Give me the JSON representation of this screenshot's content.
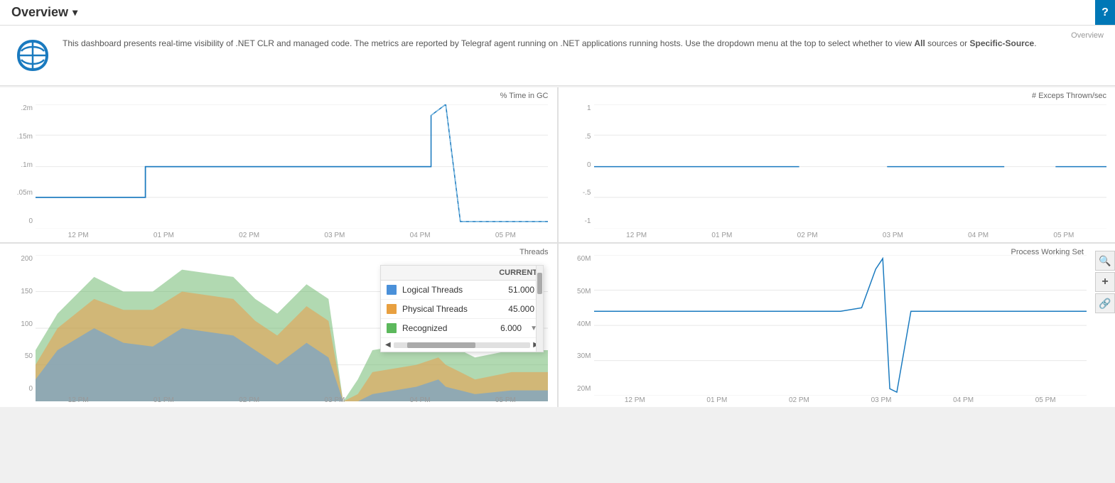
{
  "header": {
    "title": "Overview",
    "dropdown_icon": "▾",
    "right_btn": "?"
  },
  "banner": {
    "label": "Overview",
    "description_part1": "This dashboard presents real-time visibility of .NET CLR and managed code. The metrics are reported by Telegraf agent running on .NET applications running hosts. Use the dropdown menu at the top to select whether to view ",
    "bold1": "All",
    "description_part2": " sources or ",
    "bold2": "Specific-Source",
    "description_part3": "."
  },
  "charts": {
    "top_left": {
      "title": "% Time in GC",
      "y_labels": [
        ".2m",
        ".15m",
        ".1m",
        ".05m",
        "0"
      ],
      "x_labels": [
        "12 PM",
        "01 PM",
        "02 PM",
        "03 PM",
        "04 PM",
        "05 PM"
      ]
    },
    "top_right": {
      "title": "# Exceps Thrown/sec",
      "y_labels": [
        "1",
        ".5",
        "0",
        "-.5",
        "-1"
      ],
      "x_labels": [
        "12 PM",
        "01 PM",
        "02 PM",
        "03 PM",
        "04 PM",
        "05 PM"
      ]
    },
    "bottom_left": {
      "title": "Threads",
      "y_labels": [
        "200",
        "150",
        "100",
        "50",
        "0"
      ],
      "x_labels": [
        "12 PM",
        "01 PM",
        "02 PM",
        "03 PM",
        "04 PM",
        "05 PM"
      ]
    },
    "bottom_right": {
      "title": "Process Working Set",
      "y_labels": [
        "60M",
        "50M",
        "40M",
        "30M",
        "20M"
      ],
      "x_labels": [
        "12 PM",
        "01 PM",
        "02 PM",
        "03 PM",
        "04 PM",
        "05 PM"
      ]
    }
  },
  "legend": {
    "header": "CURRENT",
    "items": [
      {
        "name": "Logical Threads",
        "value": "51.000",
        "color": "#4a90d9"
      },
      {
        "name": "Physical Threads",
        "value": "45.000",
        "color": "#e8a040"
      },
      {
        "name": "Recognized",
        "value": "6.000",
        "color": "#5cb85c"
      }
    ]
  },
  "tools": {
    "search": "🔍",
    "plus": "+",
    "link": "🔗"
  }
}
